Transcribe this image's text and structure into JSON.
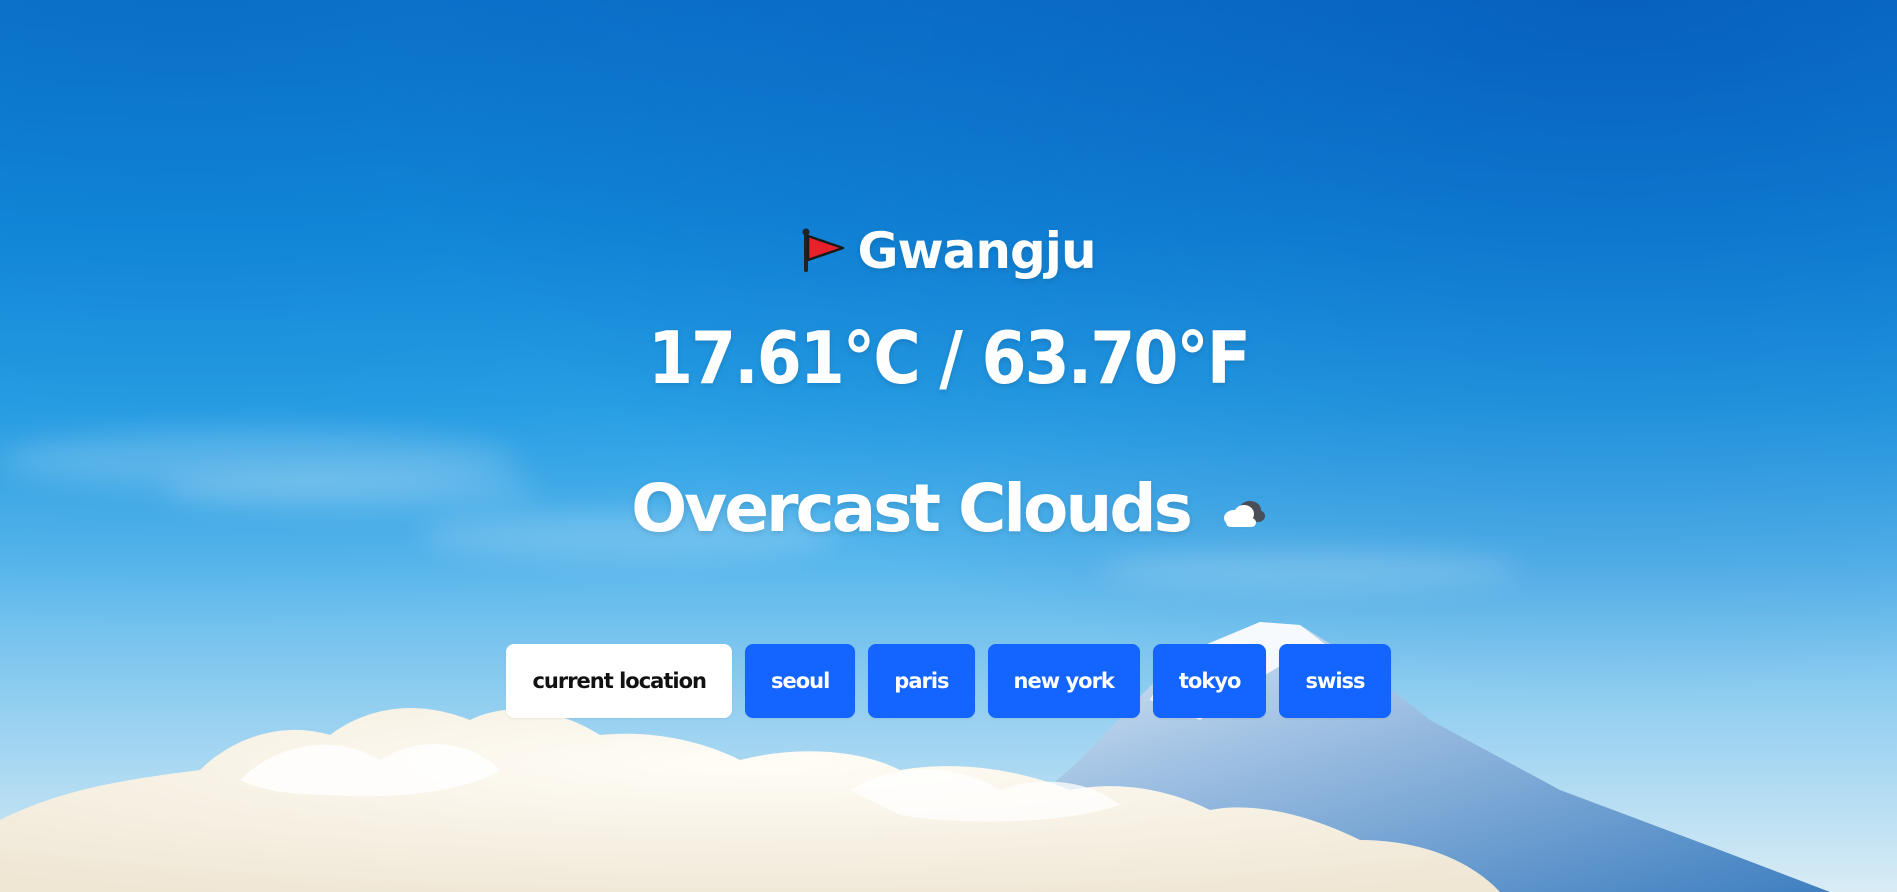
{
  "weather": {
    "location_flag_icon": "red-flag-icon",
    "city": "Gwangju",
    "temperature": "17.61°C / 63.70°F",
    "description": "Overcast Clouds",
    "description_icon": "cloud-icon"
  },
  "city_buttons": [
    {
      "label": "current location",
      "active": true
    },
    {
      "label": "seoul",
      "active": false
    },
    {
      "label": "paris",
      "active": false
    },
    {
      "label": "new york",
      "active": false
    },
    {
      "label": "tokyo",
      "active": false
    },
    {
      "label": "swiss",
      "active": false
    }
  ],
  "colors": {
    "button_bg": "#1464ff",
    "button_active_bg": "#ffffff",
    "text": "#ffffff"
  }
}
